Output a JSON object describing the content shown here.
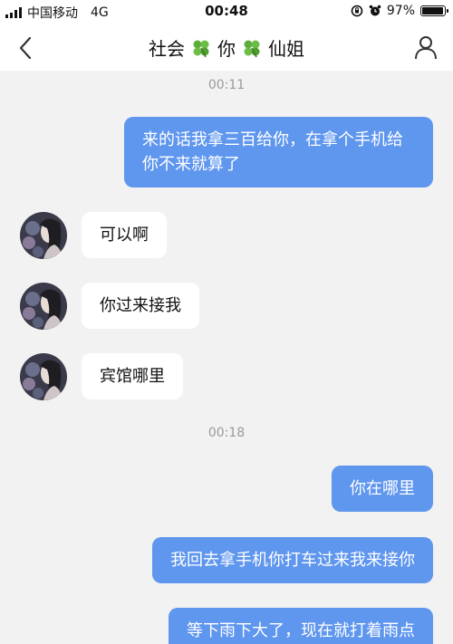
{
  "status_bar": {
    "carrier": "中国移动",
    "network": "4G",
    "time": "00:48",
    "battery_percent_label": "97%",
    "battery_level": 0.97
  },
  "nav": {
    "title_left": "社会",
    "title_middle": "你",
    "title_right": "仙姐",
    "clover_icon": "four-leaf-clover-icon",
    "back_icon": "chevron-left-icon",
    "profile_icon": "person-icon"
  },
  "messages": {
    "ts1": "00:11",
    "out1": "来的话我拿三百给你，在拿个手机给你不来就算了",
    "in1": "可以啊",
    "in2": "你过来接我",
    "in3": "宾馆哪里",
    "ts2": "00:18",
    "out2": "你在哪里",
    "out3": "我回去拿手机你打车过来我来接你",
    "out4": "等下雨下大了，现在就打着雨点"
  },
  "colors": {
    "outgoing_bubble": "#5f96ee",
    "incoming_bubble": "#ffffff",
    "background": "#f2f2f2",
    "timestamp": "#9a9a9a"
  }
}
